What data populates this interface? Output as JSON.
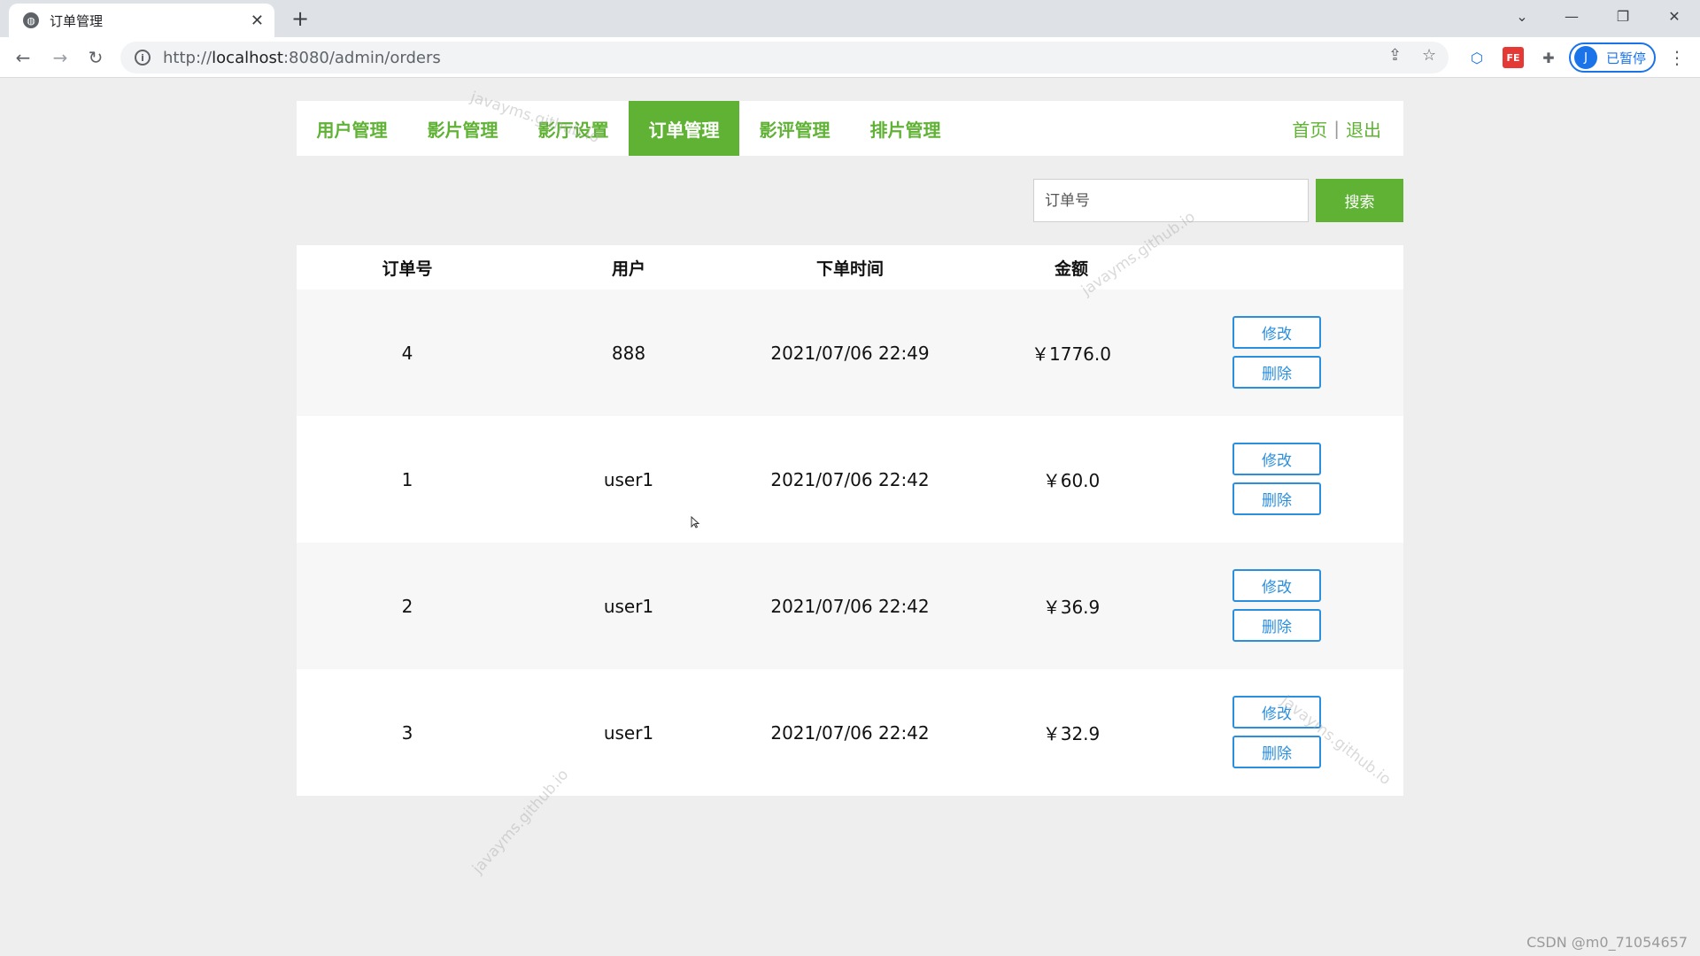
{
  "browser": {
    "tab_title": "订单管理",
    "url_prefix": "http://",
    "url_host": "localhost",
    "url_rest": ":8080/admin/orders",
    "profile_initial": "J",
    "profile_status": "已暂停",
    "ext_fe_label": "FE"
  },
  "nav": {
    "items": [
      {
        "label": "用户管理",
        "active": false
      },
      {
        "label": "影片管理",
        "active": false
      },
      {
        "label": "影厅设置",
        "active": false
      },
      {
        "label": "订单管理",
        "active": true
      },
      {
        "label": "影评管理",
        "active": false
      },
      {
        "label": "排片管理",
        "active": false
      }
    ],
    "home": "首页",
    "sep": "|",
    "logout": "退出"
  },
  "search": {
    "placeholder": "订单号",
    "button": "搜索"
  },
  "table": {
    "columns": [
      "订单号",
      "用户",
      "下单时间",
      "金额"
    ],
    "rows": [
      {
        "id": "4",
        "user": "888",
        "time": "2021/07/06 22:49",
        "amount": "￥1776.0"
      },
      {
        "id": "1",
        "user": "user1",
        "time": "2021/07/06 22:42",
        "amount": "￥60.0"
      },
      {
        "id": "2",
        "user": "user1",
        "time": "2021/07/06 22:42",
        "amount": "￥36.9"
      },
      {
        "id": "3",
        "user": "user1",
        "time": "2021/07/06 22:42",
        "amount": "￥32.9"
      }
    ],
    "edit_label": "修改",
    "delete_label": "删除"
  },
  "watermarks": {
    "text": "javayms.github.io",
    "footer": "CSDN @m0_71054657"
  },
  "colors": {
    "brand_green": "#5fb234",
    "button_blue": "#2b8fe0",
    "page_bg": "#eeeeee"
  }
}
